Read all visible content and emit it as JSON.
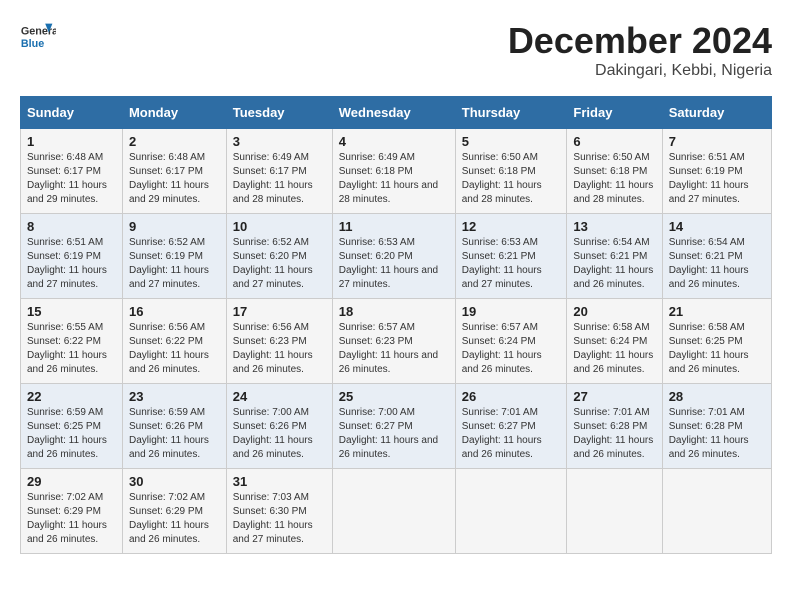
{
  "header": {
    "logo_line1": "General",
    "logo_line2": "Blue",
    "month": "December 2024",
    "location": "Dakingari, Kebbi, Nigeria"
  },
  "days_of_week": [
    "Sunday",
    "Monday",
    "Tuesday",
    "Wednesday",
    "Thursday",
    "Friday",
    "Saturday"
  ],
  "weeks": [
    [
      {
        "day": "1",
        "info": "Sunrise: 6:48 AM\nSunset: 6:17 PM\nDaylight: 11 hours and 29 minutes."
      },
      {
        "day": "2",
        "info": "Sunrise: 6:48 AM\nSunset: 6:17 PM\nDaylight: 11 hours and 29 minutes."
      },
      {
        "day": "3",
        "info": "Sunrise: 6:49 AM\nSunset: 6:17 PM\nDaylight: 11 hours and 28 minutes."
      },
      {
        "day": "4",
        "info": "Sunrise: 6:49 AM\nSunset: 6:18 PM\nDaylight: 11 hours and 28 minutes."
      },
      {
        "day": "5",
        "info": "Sunrise: 6:50 AM\nSunset: 6:18 PM\nDaylight: 11 hours and 28 minutes."
      },
      {
        "day": "6",
        "info": "Sunrise: 6:50 AM\nSunset: 6:18 PM\nDaylight: 11 hours and 28 minutes."
      },
      {
        "day": "7",
        "info": "Sunrise: 6:51 AM\nSunset: 6:19 PM\nDaylight: 11 hours and 27 minutes."
      }
    ],
    [
      {
        "day": "8",
        "info": "Sunrise: 6:51 AM\nSunset: 6:19 PM\nDaylight: 11 hours and 27 minutes."
      },
      {
        "day": "9",
        "info": "Sunrise: 6:52 AM\nSunset: 6:19 PM\nDaylight: 11 hours and 27 minutes."
      },
      {
        "day": "10",
        "info": "Sunrise: 6:52 AM\nSunset: 6:20 PM\nDaylight: 11 hours and 27 minutes."
      },
      {
        "day": "11",
        "info": "Sunrise: 6:53 AM\nSunset: 6:20 PM\nDaylight: 11 hours and 27 minutes."
      },
      {
        "day": "12",
        "info": "Sunrise: 6:53 AM\nSunset: 6:21 PM\nDaylight: 11 hours and 27 minutes."
      },
      {
        "day": "13",
        "info": "Sunrise: 6:54 AM\nSunset: 6:21 PM\nDaylight: 11 hours and 26 minutes."
      },
      {
        "day": "14",
        "info": "Sunrise: 6:54 AM\nSunset: 6:21 PM\nDaylight: 11 hours and 26 minutes."
      }
    ],
    [
      {
        "day": "15",
        "info": "Sunrise: 6:55 AM\nSunset: 6:22 PM\nDaylight: 11 hours and 26 minutes."
      },
      {
        "day": "16",
        "info": "Sunrise: 6:56 AM\nSunset: 6:22 PM\nDaylight: 11 hours and 26 minutes."
      },
      {
        "day": "17",
        "info": "Sunrise: 6:56 AM\nSunset: 6:23 PM\nDaylight: 11 hours and 26 minutes."
      },
      {
        "day": "18",
        "info": "Sunrise: 6:57 AM\nSunset: 6:23 PM\nDaylight: 11 hours and 26 minutes."
      },
      {
        "day": "19",
        "info": "Sunrise: 6:57 AM\nSunset: 6:24 PM\nDaylight: 11 hours and 26 minutes."
      },
      {
        "day": "20",
        "info": "Sunrise: 6:58 AM\nSunset: 6:24 PM\nDaylight: 11 hours and 26 minutes."
      },
      {
        "day": "21",
        "info": "Sunrise: 6:58 AM\nSunset: 6:25 PM\nDaylight: 11 hours and 26 minutes."
      }
    ],
    [
      {
        "day": "22",
        "info": "Sunrise: 6:59 AM\nSunset: 6:25 PM\nDaylight: 11 hours and 26 minutes."
      },
      {
        "day": "23",
        "info": "Sunrise: 6:59 AM\nSunset: 6:26 PM\nDaylight: 11 hours and 26 minutes."
      },
      {
        "day": "24",
        "info": "Sunrise: 7:00 AM\nSunset: 6:26 PM\nDaylight: 11 hours and 26 minutes."
      },
      {
        "day": "25",
        "info": "Sunrise: 7:00 AM\nSunset: 6:27 PM\nDaylight: 11 hours and 26 minutes."
      },
      {
        "day": "26",
        "info": "Sunrise: 7:01 AM\nSunset: 6:27 PM\nDaylight: 11 hours and 26 minutes."
      },
      {
        "day": "27",
        "info": "Sunrise: 7:01 AM\nSunset: 6:28 PM\nDaylight: 11 hours and 26 minutes."
      },
      {
        "day": "28",
        "info": "Sunrise: 7:01 AM\nSunset: 6:28 PM\nDaylight: 11 hours and 26 minutes."
      }
    ],
    [
      {
        "day": "29",
        "info": "Sunrise: 7:02 AM\nSunset: 6:29 PM\nDaylight: 11 hours and 26 minutes."
      },
      {
        "day": "30",
        "info": "Sunrise: 7:02 AM\nSunset: 6:29 PM\nDaylight: 11 hours and 26 minutes."
      },
      {
        "day": "31",
        "info": "Sunrise: 7:03 AM\nSunset: 6:30 PM\nDaylight: 11 hours and 27 minutes."
      },
      {
        "day": "",
        "info": ""
      },
      {
        "day": "",
        "info": ""
      },
      {
        "day": "",
        "info": ""
      },
      {
        "day": "",
        "info": ""
      }
    ]
  ]
}
